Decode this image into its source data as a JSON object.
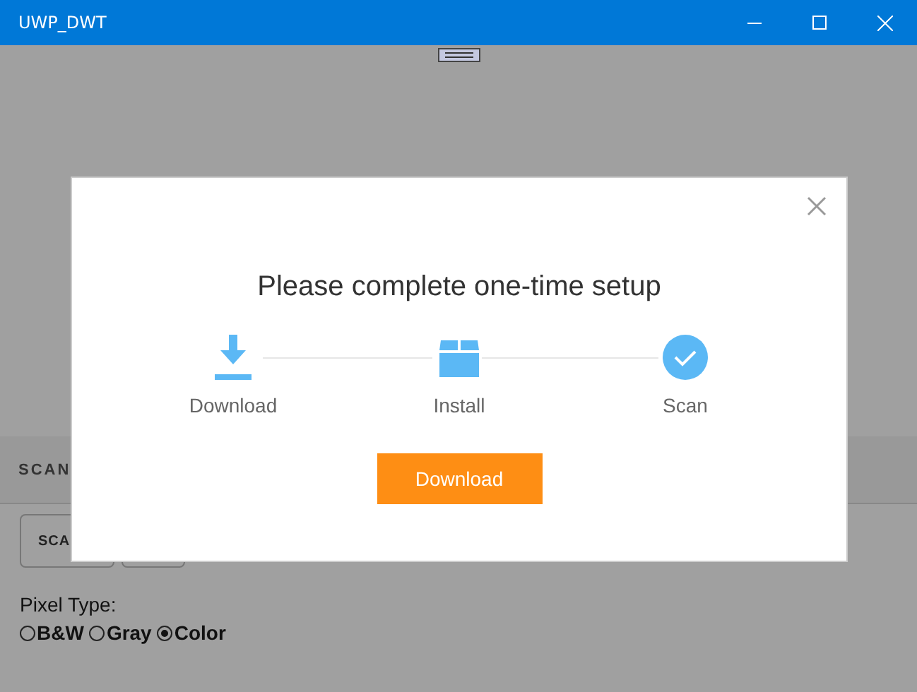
{
  "window": {
    "title": "UWP_DWT"
  },
  "background": {
    "tab_label": "SCAN",
    "buttons": [
      "SCA"
    ],
    "pixel_type": {
      "label": "Pixel Type:",
      "options": [
        {
          "label": "B&W",
          "selected": false
        },
        {
          "label": "Gray",
          "selected": false
        },
        {
          "label": "Color",
          "selected": true
        }
      ]
    }
  },
  "dialog": {
    "title": "Please complete one-time setup",
    "steps": [
      {
        "kind": "download",
        "label": "Download"
      },
      {
        "kind": "install",
        "label": "Install"
      },
      {
        "kind": "scan",
        "label": "Scan"
      }
    ],
    "button": "Download"
  }
}
